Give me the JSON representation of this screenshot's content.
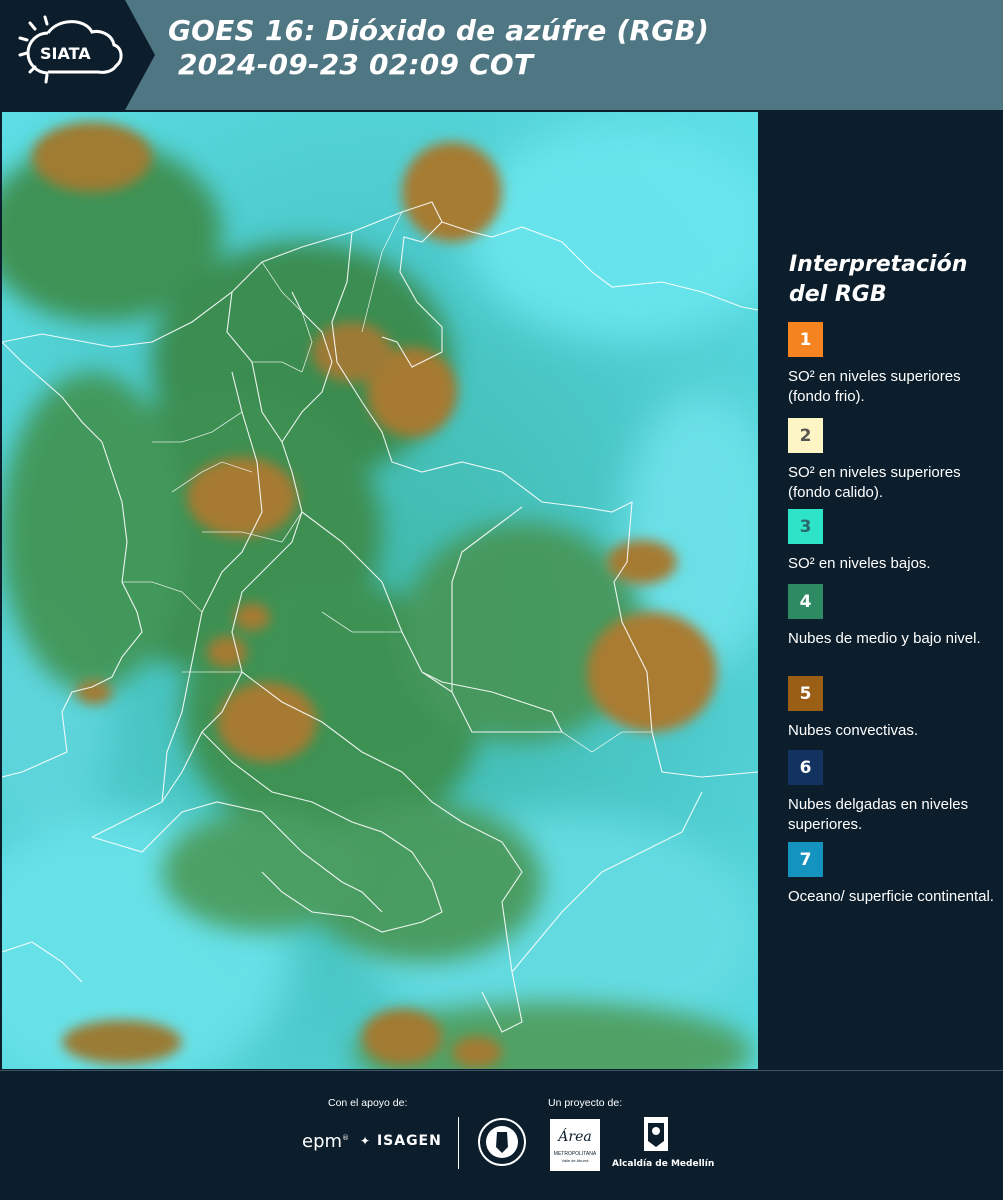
{
  "header": {
    "logo_text": "SIATA",
    "title_line1": "GOES 16: Dióxido de azúfre (RGB)",
    "title_line2": "2024-09-23 02:09 COT"
  },
  "map": {
    "content": "GOES-16 SO2 RGB satellite composite over Colombia with department boundaries"
  },
  "legend": {
    "title_line1": "Interpretación",
    "title_line2": "del RGB",
    "items": [
      {
        "number": "1",
        "color": "#f5831f",
        "number_color": "#ffffff",
        "label": "SO² en niveles superiores (fondo frio)."
      },
      {
        "number": "2",
        "color": "#fdf5c4",
        "number_color": "#555555",
        "label": "SO² en niveles superiores (fondo calido)."
      },
      {
        "number": "3",
        "color": "#2de4c9",
        "number_color": "#2a6a6a",
        "label": "SO² en niveles bajos."
      },
      {
        "number": "4",
        "color": "#2e8a63",
        "number_color": "#ffffff",
        "label": "Nubes de medio y bajo nivel."
      },
      {
        "number": "5",
        "color": "#9a5f14",
        "number_color": "#ffffff",
        "label": "Nubes convectivas."
      },
      {
        "number": "6",
        "color": "#123260",
        "number_color": "#ffffff",
        "label": "Nubes delgadas en niveles superiores."
      },
      {
        "number": "7",
        "color": "#1593bf",
        "number_color": "#ffffff",
        "label": "Oceano/ superficie continental."
      }
    ]
  },
  "footer": {
    "support_label": "Con el apoyo de:",
    "project_label": "Un proyecto de:",
    "epm": "epm",
    "isagen": "ISAGEN",
    "area_text": "Área",
    "area_sub": "METROPOLITANA",
    "area_sub2": "Valle de Aburrá",
    "alcaldia": "Alcaldía de Medellín"
  }
}
